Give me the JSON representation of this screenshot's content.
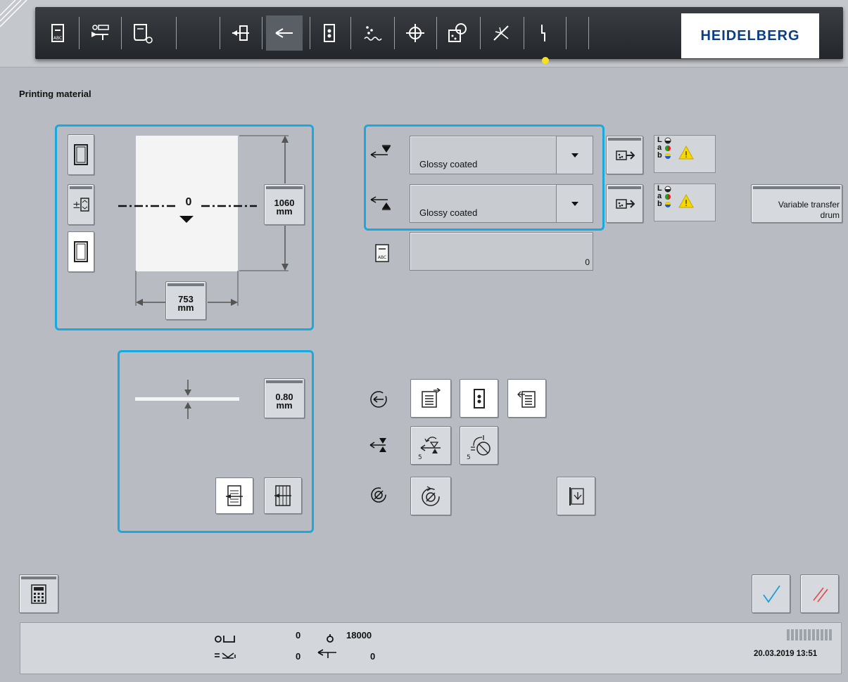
{
  "page": {
    "title": "Printing material"
  },
  "brand": {
    "name": "HEIDELBERG",
    "color": "#0b3e86",
    "accent": "#f5c400"
  },
  "colors": {
    "panel_border": "#1aa9df",
    "status_dot": "#f6e11a",
    "ok_check": "#1aa0d8",
    "cancel_mark": "#e24a4a"
  },
  "toolbar": {
    "icons": [
      "sheet-abc-icon",
      "counter-feed-icon",
      "scroll-clock-icon",
      "feeder-icon",
      "transport-direction-icon",
      "register-icon",
      "powder-icon",
      "crosshair-icon",
      "measure-icon",
      "dryer-icon",
      "fault-icon"
    ],
    "active": "transport-direction-icon"
  },
  "format": {
    "height_value": "1060",
    "height_unit": "mm",
    "width_value": "753",
    "width_unit": "mm",
    "center_offset": "0"
  },
  "thickness": {
    "value": "0.80",
    "unit": "mm"
  },
  "material": {
    "front": {
      "label": "Glossy coated"
    },
    "back": {
      "label": "Glossy coated"
    },
    "name_field_value": "0",
    "lab_labels": [
      "L",
      "a",
      "b"
    ]
  },
  "variable_transfer_button": {
    "line1": "Variable transfer",
    "line2": "drum"
  },
  "small_labels": {
    "step_a": "5",
    "step_b": "5"
  },
  "status_bar": {
    "counter1_value": "0",
    "counter2_value": "18000",
    "counter3_value": "0",
    "counter4_value": "0",
    "datetime": "20.03.2019 13:51"
  }
}
